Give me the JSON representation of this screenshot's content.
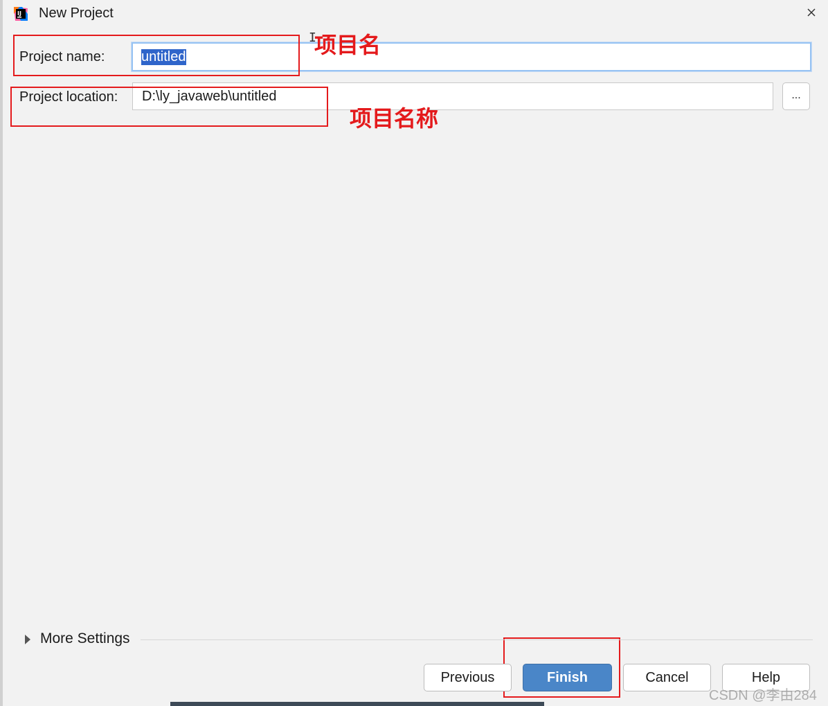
{
  "window": {
    "title": "New Project",
    "app_icon": "intellij-idea-icon"
  },
  "form": {
    "project_name": {
      "label": "Project name:",
      "value": "untitled"
    },
    "project_location": {
      "label": "Project location:",
      "value": "D:\\ly_javaweb\\untitled",
      "browse_label": "..."
    }
  },
  "annotations": {
    "name_note": "项目名",
    "location_note": "项目名称"
  },
  "more_settings": {
    "label": "More Settings"
  },
  "buttons": {
    "previous": "Previous",
    "finish": "Finish",
    "cancel": "Cancel",
    "help": "Help"
  },
  "watermark": "CSDN @李由284",
  "colors": {
    "primary_button": "#4a86c8",
    "annotation_red": "#e41a1c",
    "focus_border": "#97c3f3",
    "selection": "#2f65ca"
  }
}
